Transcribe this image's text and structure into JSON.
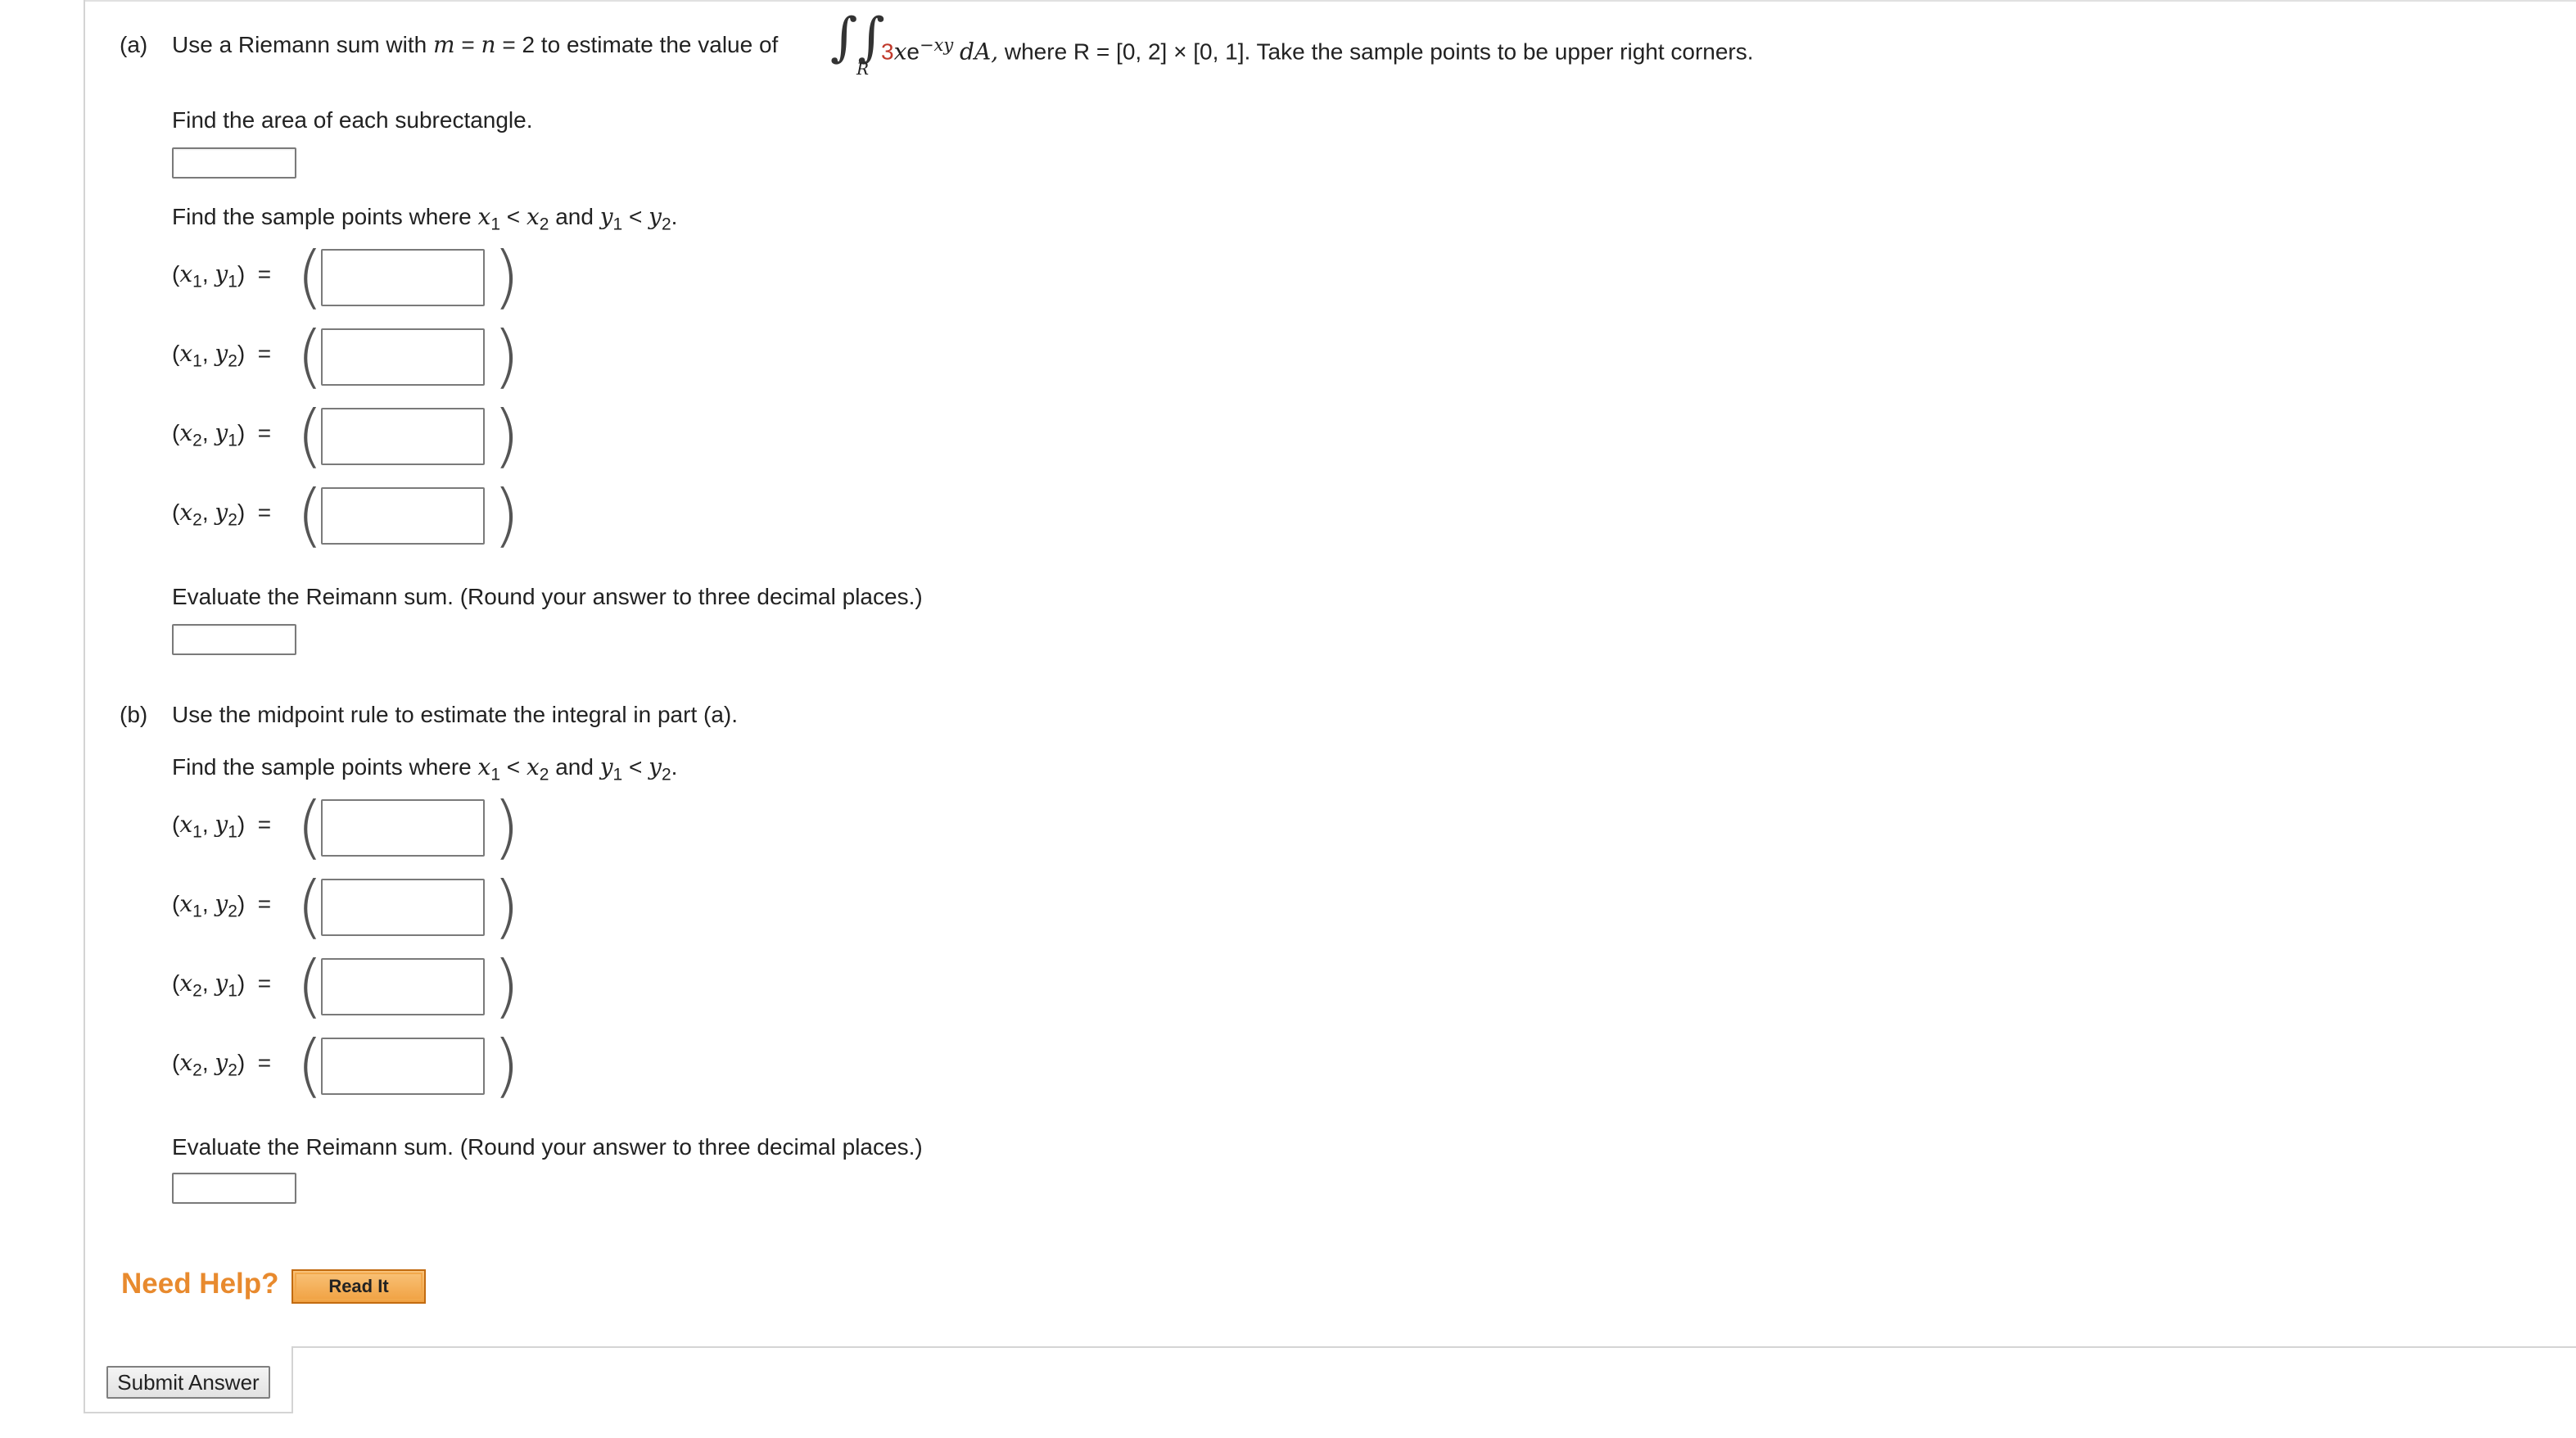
{
  "part_a": {
    "label": "(a)",
    "prompt_before": "Use a Riemann sum with ",
    "prompt_m": "m",
    "prompt_eq1": " = ",
    "prompt_n": "n",
    "prompt_eq2": " = 2 to estimate the value of",
    "integrand_coeff": "3",
    "integrand_x": "x",
    "integrand_e": "e",
    "integrand_exp": "−xy",
    "integral_region": "R",
    "d_a": "dA,",
    "prompt_after": " where R = [0, 2] × [0, 1]. Take the sample points to be upper right corners.",
    "area_prompt": "Find the area of each subrectangle.",
    "sample_prompt_pre": "Find the sample points where ",
    "sample_prompt_mid": " and ",
    "sample_prompt_end": ".",
    "points": [
      {
        "label_x": "x",
        "label_xi": "1",
        "label_y": "y",
        "label_yi": "1"
      },
      {
        "label_x": "x",
        "label_xi": "1",
        "label_y": "y",
        "label_yi": "2"
      },
      {
        "label_x": "x",
        "label_xi": "2",
        "label_y": "y",
        "label_yi": "1"
      },
      {
        "label_x": "x",
        "label_xi": "2",
        "label_y": "y",
        "label_yi": "2"
      }
    ],
    "eval_prompt": "Evaluate the Reimann sum. (Round your answer to three decimal places.)"
  },
  "part_b": {
    "label": "(b)",
    "prompt": "Use the midpoint rule to estimate the integral in part (a).",
    "sample_prompt_pre": "Find the sample points where ",
    "sample_prompt_mid": " and ",
    "sample_prompt_end": ".",
    "eval_prompt": "Evaluate the Reimann sum. (Round your answer to three decimal places.)"
  },
  "ineq": {
    "x1": "x",
    "x1s": "1",
    "lt": " < ",
    "x2": "x",
    "x2s": "2",
    "y1": "y",
    "y1s": "1",
    "y2": "y",
    "y2s": "2"
  },
  "help": {
    "need_help": "Need Help?",
    "read_it": "Read It"
  },
  "submit_label": "Submit Answer",
  "colors": {
    "accent_orange": "#e88a2e",
    "integrand_red": "#c0392b"
  }
}
